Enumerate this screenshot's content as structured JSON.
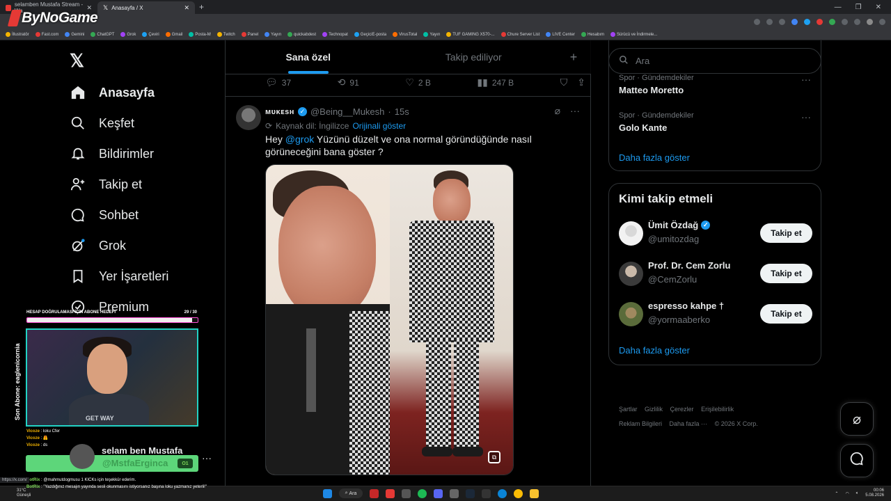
{
  "browser": {
    "tabs": [
      {
        "title": "selamben Mustafa Stream - Wa",
        "active": false
      },
      {
        "title": "Anasayfa / X",
        "active": true
      }
    ],
    "bookmarks": [
      "İllustratör",
      "Fast.com",
      "Gemini",
      "ChatGPT",
      "Grok",
      "Çeviri",
      "Gmail",
      "Posta-M",
      "Twitch",
      "Panel",
      "Yayın",
      "quickabdest",
      "Technopat",
      "GeçiciE-posta",
      "VirusTotal",
      "Yayın",
      "TUF GAMING X570-...",
      "Chure Server List",
      "LIVE Center",
      "Hesabım",
      "Sürücü ve İndirmele..."
    ],
    "status_url": "https://x.com/"
  },
  "overlay": {
    "logo": "ByNoGame",
    "sub_goal_label": "HESAP DOĞRULAMASI İÇİN ABONE HEDEFİ",
    "sub_goal_count": "29 / 30",
    "sub_goal_progress": 0.967,
    "last_sub": "Son Abone: eaglenicornia",
    "webcam_shirt_text": "GET WAY",
    "chat": [
      {
        "user": "Vicoze",
        "text": "loku Cfer"
      },
      {
        "user": "Vicoze",
        "text": "🦺"
      },
      {
        "user": "Vicoze",
        "text": "ds"
      }
    ],
    "bot_lines": [
      {
        "user": "BotRix",
        "text": "@mahmutdogmusu 1 KICKs için teşekkür ederim."
      },
      {
        "user": "BotRix",
        "text": "\"Yazdığınız mesajın yayında sesli okunmasını istiyorsanız başına loku yazmanız yeterli!\""
      }
    ],
    "streamer_name": "selam ben Mustafa",
    "streamer_handle": "@MstfaErginca",
    "green_badge": "O1"
  },
  "nav": {
    "items": [
      {
        "label": "Anasayfa",
        "icon": "home-icon",
        "bold": true
      },
      {
        "label": "Keşfet",
        "icon": "search-icon",
        "bold": false
      },
      {
        "label": "Bildirimler",
        "icon": "bell-icon",
        "bold": false
      },
      {
        "label": "Takip et",
        "icon": "person-add-icon",
        "bold": false
      },
      {
        "label": "Sohbet",
        "icon": "chat-icon",
        "bold": false
      },
      {
        "label": "Grok",
        "icon": "grok-icon",
        "bold": false
      },
      {
        "label": "Yer İşaretleri",
        "icon": "bookmark-icon",
        "bold": false
      },
      {
        "label": "Premium",
        "icon": "premium-icon",
        "bold": false
      }
    ]
  },
  "feed": {
    "tabs": [
      "Sana özel",
      "Takip ediliyor"
    ],
    "prev_tweet": {
      "replies": "37",
      "reposts": "91",
      "likes": "2 B",
      "views": "247 B"
    },
    "tweet": {
      "author": "ᴍᴜᴋᴇsʜ",
      "handle": "@Being__Mukesh",
      "time": "15s",
      "translated_from": "Kaynak dil: İngilizce",
      "show_original": "Orijinali göster",
      "text_prefix": "Hey ",
      "mention": "@grok",
      "text_body": " Yüzünü düzelt ve ona normal göründüğünde nasıl görüneceğini bana göster ?",
      "alt_badge": "⧉"
    }
  },
  "sidebar": {
    "search_placeholder": "Ara",
    "trends": [
      {
        "category": "Spor · Gündemdekiler",
        "name": "Matteo Moretto"
      },
      {
        "category": "Spor · Gündemdekiler",
        "name": "Golo Kante"
      }
    ],
    "trends_more": "Daha fazla göster",
    "who_to_follow_title": "Kimi takip etmeli",
    "who_to_follow": [
      {
        "name": "Ümit Özdağ",
        "handle": "@umitozdag",
        "verified": true,
        "button": "Takip et"
      },
      {
        "name": "Prof. Dr. Cem Zorlu",
        "handle": "@CemZorlu",
        "verified": false,
        "button": "Takip et"
      },
      {
        "name": "espresso kahpe †",
        "handle": "@yormaaberko",
        "verified": false,
        "button": "Takip et"
      }
    ],
    "wtf_more": "Daha fazla göster",
    "footer": [
      "Şartlar",
      "Gizlilik",
      "Çerezler",
      "Erişilebilirlik",
      "Reklam Bilgileri",
      "Daha fazla ···",
      "© 2026 X Corp."
    ]
  },
  "taskbar": {
    "weather": "31°C",
    "weather_sub": "Güneşli",
    "search_label": "Ara",
    "time": "00:06",
    "date": "5.08.2026"
  },
  "colors": {
    "accent": "#1d9bf0",
    "background": "#000000",
    "border": "#2f3336"
  }
}
